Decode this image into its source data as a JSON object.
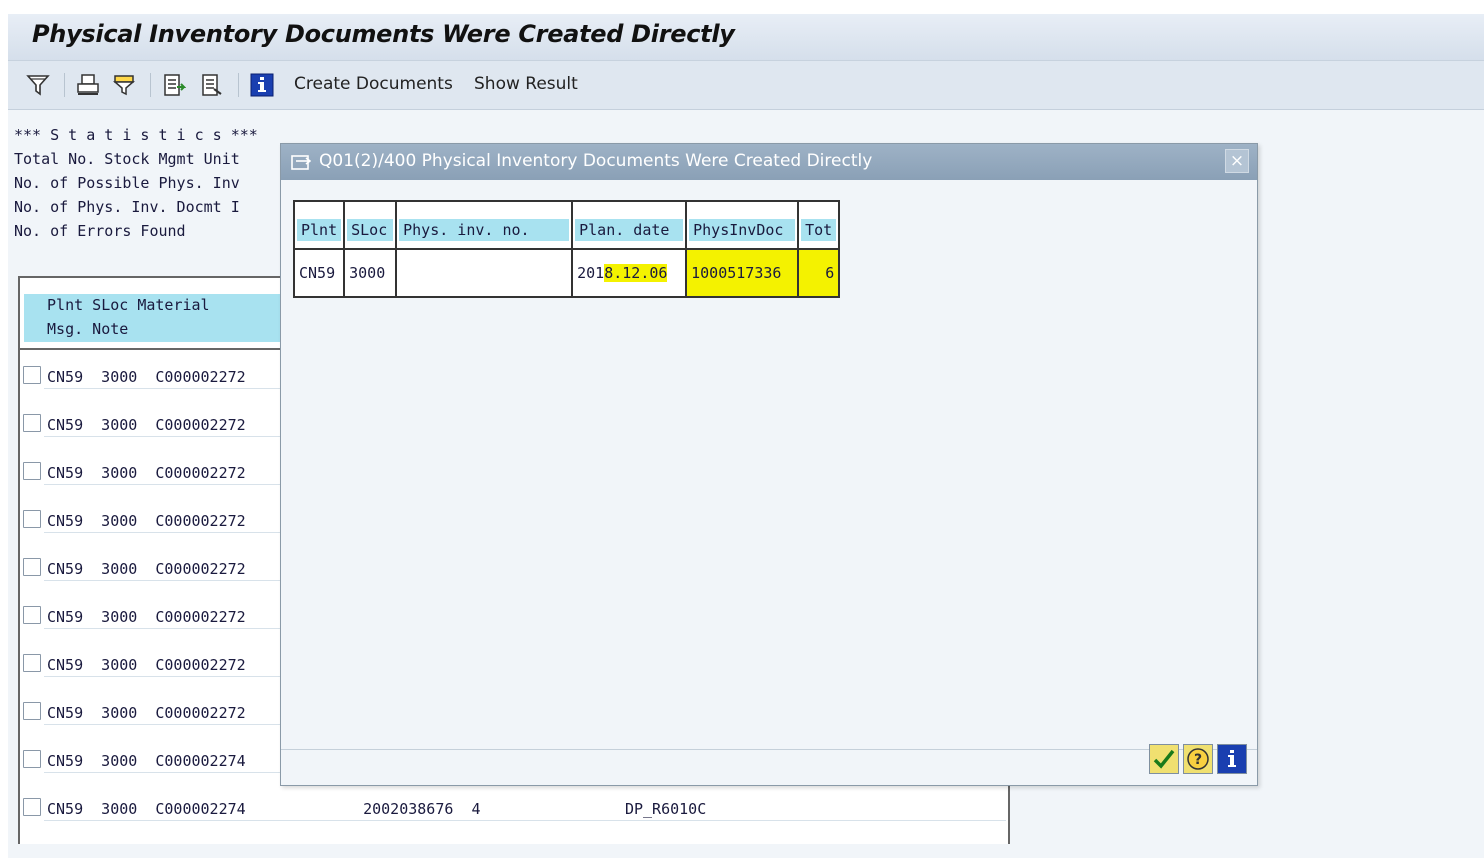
{
  "window": {
    "title": "Physical Inventory Documents Were Created Directly"
  },
  "toolbar": {
    "icons": [
      "filter-icon",
      "print-icon",
      "print-filter-icon",
      "export-icon",
      "export-local-icon",
      "info-icon"
    ],
    "create_documents_label": "Create Documents",
    "show_result_label": "Show Result"
  },
  "statistics": {
    "heading": "*** S t a t i s t i c s ***",
    "lines": [
      "Total No. Stock Mgmt Unit",
      "No. of Possible Phys. Inv",
      "No. of Phys. Inv. Docmt I",
      "No. of Errors Found"
    ]
  },
  "alv": {
    "header_line1": " Plnt SLoc Material",
    "header_line2": " Msg. Note",
    "rows": [
      "CN59  3000  C000002272",
      "CN59  3000  C000002272",
      "CN59  3000  C000002272",
      "CN59  3000  C000002272",
      "CN59  3000  C000002272",
      "CN59  3000  C000002272",
      "CN59  3000  C000002272",
      "CN59  3000  C000002272",
      "CN59  3000  C000002274",
      "CN59  3000  C000002274             2002038676  4                DP_R6010C"
    ]
  },
  "dialog": {
    "title": "Q01(2)/400 Physical Inventory Documents Were Created Directly",
    "close_label": "×",
    "columns": [
      "Plnt",
      "SLoc",
      "Phys. inv. no.",
      "Plan. date",
      "PhysInvDoc",
      "Tot"
    ],
    "row": {
      "plnt": "CN59",
      "sloc": "3000",
      "phys_inv_no": "",
      "plan_date_prefix": "201",
      "plan_date_rest": "8.12.06",
      "phys_inv_doc": "1000517336",
      "tot": "6"
    },
    "buttons": [
      "check-icon",
      "help-icon",
      "info-icon"
    ],
    "highlight_color": "#f4f200"
  }
}
